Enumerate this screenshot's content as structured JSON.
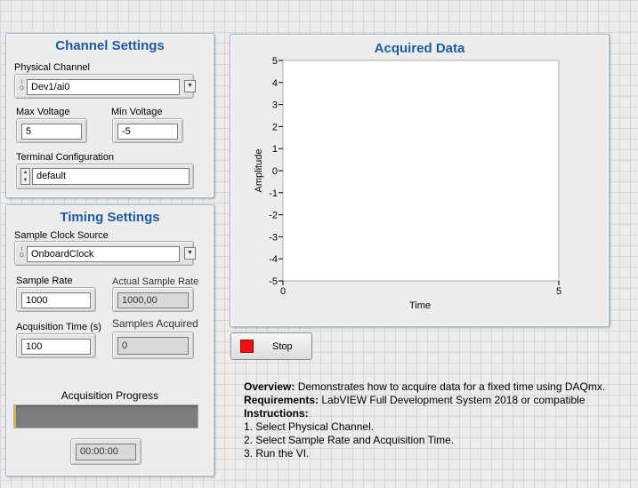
{
  "channel_settings": {
    "title": "Channel Settings",
    "physical_channel_label": "Physical Channel",
    "physical_channel_value": "Dev1/ai0",
    "max_voltage_label": "Max Voltage",
    "max_voltage_value": "5",
    "min_voltage_label": "Min Voltage",
    "min_voltage_value": "-5",
    "terminal_config_label": "Terminal Configuration",
    "terminal_config_value": "default"
  },
  "timing_settings": {
    "title": "Timing Settings",
    "sample_clock_source_label": "Sample Clock Source",
    "sample_clock_source_value": "OnboardClock",
    "sample_rate_label": "Sample Rate",
    "sample_rate_value": "1000",
    "actual_sample_rate_label": "Actual Sample Rate",
    "actual_sample_rate_value": "1000,00",
    "acquisition_time_label": "Acquisition Time (s)",
    "acquisition_time_value": "100",
    "samples_acquired_label": "Samples Acquired",
    "samples_acquired_value": "0",
    "progress_label": "Acquisition Progress",
    "progress_fraction": 0.005,
    "elapsed_time": "00:00:00"
  },
  "chart_data": {
    "type": "line",
    "title": "Acquired Data",
    "xlabel": "Time",
    "ylabel": "Amplitude",
    "xlim": [
      0,
      5
    ],
    "ylim": [
      -5,
      5
    ],
    "x_ticks": [
      "0",
      "5"
    ],
    "y_ticks": [
      "5",
      "4",
      "3",
      "2",
      "1",
      "0",
      "-1",
      "-2",
      "-3",
      "-4",
      "-5"
    ],
    "series": []
  },
  "stop_button": {
    "label": "Stop",
    "led_color": "#ee1111"
  },
  "description": {
    "overview_label": "Overview:",
    "overview_text": " Demonstrates how to acquire data for a fixed time using DAQmx.",
    "requirements_label": "Requirements:",
    "requirements_text": " LabVIEW Full Development System 2018 or compatible",
    "instructions_label": "Instructions:",
    "steps": [
      "1. Select Physical Channel.",
      "2. Select Sample Rate and Acquisition Time.",
      "3. Run the VI."
    ]
  },
  "colors": {
    "title_blue": "#1f5a9e",
    "panel_border": "#9ab3cc",
    "progress_fill": "#e0b040"
  }
}
